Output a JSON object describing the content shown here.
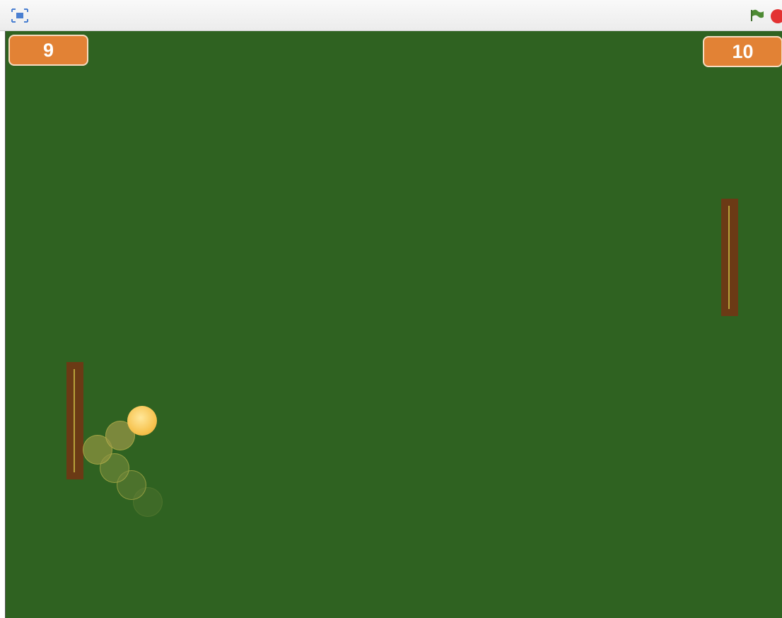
{
  "toolbar": {
    "fullscreen_icon": "fullscreen-icon",
    "flag_icon": "green-flag-icon",
    "stop_icon": "stop-icon"
  },
  "game": {
    "left_score": "9",
    "right_score": "10"
  },
  "colors": {
    "stage": "#2f6221",
    "score_bg": "#e28235",
    "paddle": "#6b3a15",
    "ball": "#f7c451",
    "stop": "#e33232"
  }
}
